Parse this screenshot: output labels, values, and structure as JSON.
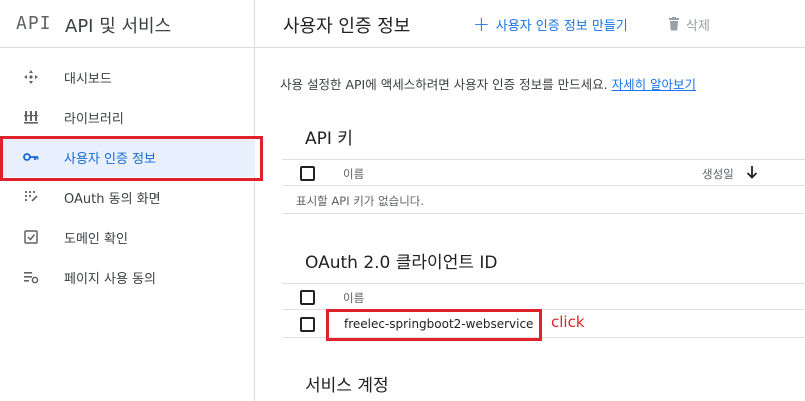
{
  "sidebar": {
    "logo": "API",
    "title": "API 및 서비스",
    "items": [
      {
        "label": "대시보드",
        "icon": "dashboard-icon"
      },
      {
        "label": "라이브러리",
        "icon": "library-icon"
      },
      {
        "label": "사용자 인증 정보",
        "icon": "key-icon",
        "active": true
      },
      {
        "label": "OAuth 동의 화면",
        "icon": "oauth-consent-icon"
      },
      {
        "label": "도메인 확인",
        "icon": "domain-verify-icon"
      },
      {
        "label": "페이지 사용 동의",
        "icon": "page-consent-icon"
      }
    ]
  },
  "header": {
    "title": "사용자 인증 정보",
    "create_label": "사용자 인증 정보 만들기",
    "delete_label": "삭제"
  },
  "main": {
    "description": "사용 설정한 API에 액세스하려면 사용자 인증 정보를 만드세요.",
    "learn_more": "자세히 알아보기",
    "api_keys": {
      "title": "API 키",
      "col_name": "이름",
      "col_created": "생성일",
      "empty": "표시할 API 키가 없습니다."
    },
    "oauth": {
      "title": "OAuth 2.0 클라이언트 ID",
      "col_name": "이름",
      "rows": [
        "freelec-springboot2-webservice"
      ]
    },
    "service_accounts": {
      "title": "서비스 계정"
    }
  },
  "annotation": {
    "click_label": "click"
  },
  "colors": {
    "accent": "#1a73e8",
    "active_bg": "#e8f0fe",
    "highlight": "#e0202a"
  }
}
